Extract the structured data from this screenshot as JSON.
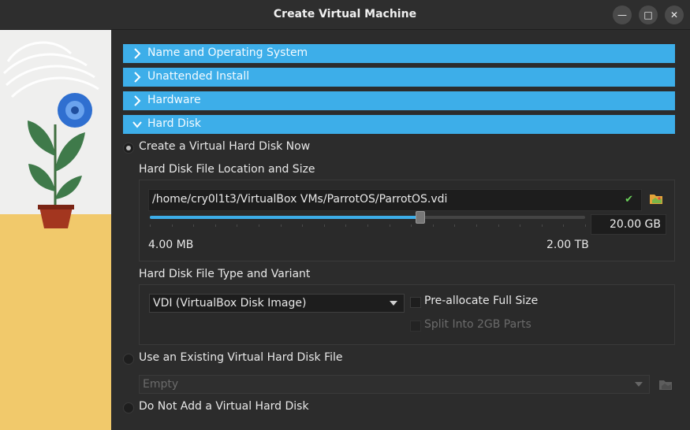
{
  "window": {
    "title": "Create Virtual Machine"
  },
  "sections": [
    {
      "label": "Name and Operating System",
      "expanded": false
    },
    {
      "label": "Unattended Install",
      "expanded": false
    },
    {
      "label": "Hardware",
      "expanded": false
    },
    {
      "label": "Hard Disk",
      "expanded": true
    }
  ],
  "hard_disk": {
    "create_option": "Create a Virtual Hard Disk Now",
    "location_size_label": "Hard Disk File Location and Size",
    "file_path": "/home/cry0l1t3/VirtualBox VMs/ParrotOS/ParrotOS.vdi",
    "size_value": "20.00 GB",
    "slider_fraction": 0.62,
    "min_label": "4.00 MB",
    "max_label": "2.00 TB",
    "type_variant_label": "Hard Disk File Type and Variant",
    "file_type": "VDI (VirtualBox Disk Image)",
    "preallocate_label": "Pre-allocate Full Size",
    "split_label": "Split Into 2GB Parts",
    "use_existing_option": "Use an Existing Virtual Hard Disk File",
    "existing_file_value": "Empty",
    "no_disk_option": "Do Not Add a Virtual Hard Disk",
    "selected_option": "create"
  },
  "colors": {
    "accent": "#3daee9",
    "background": "#2c2c2c"
  }
}
